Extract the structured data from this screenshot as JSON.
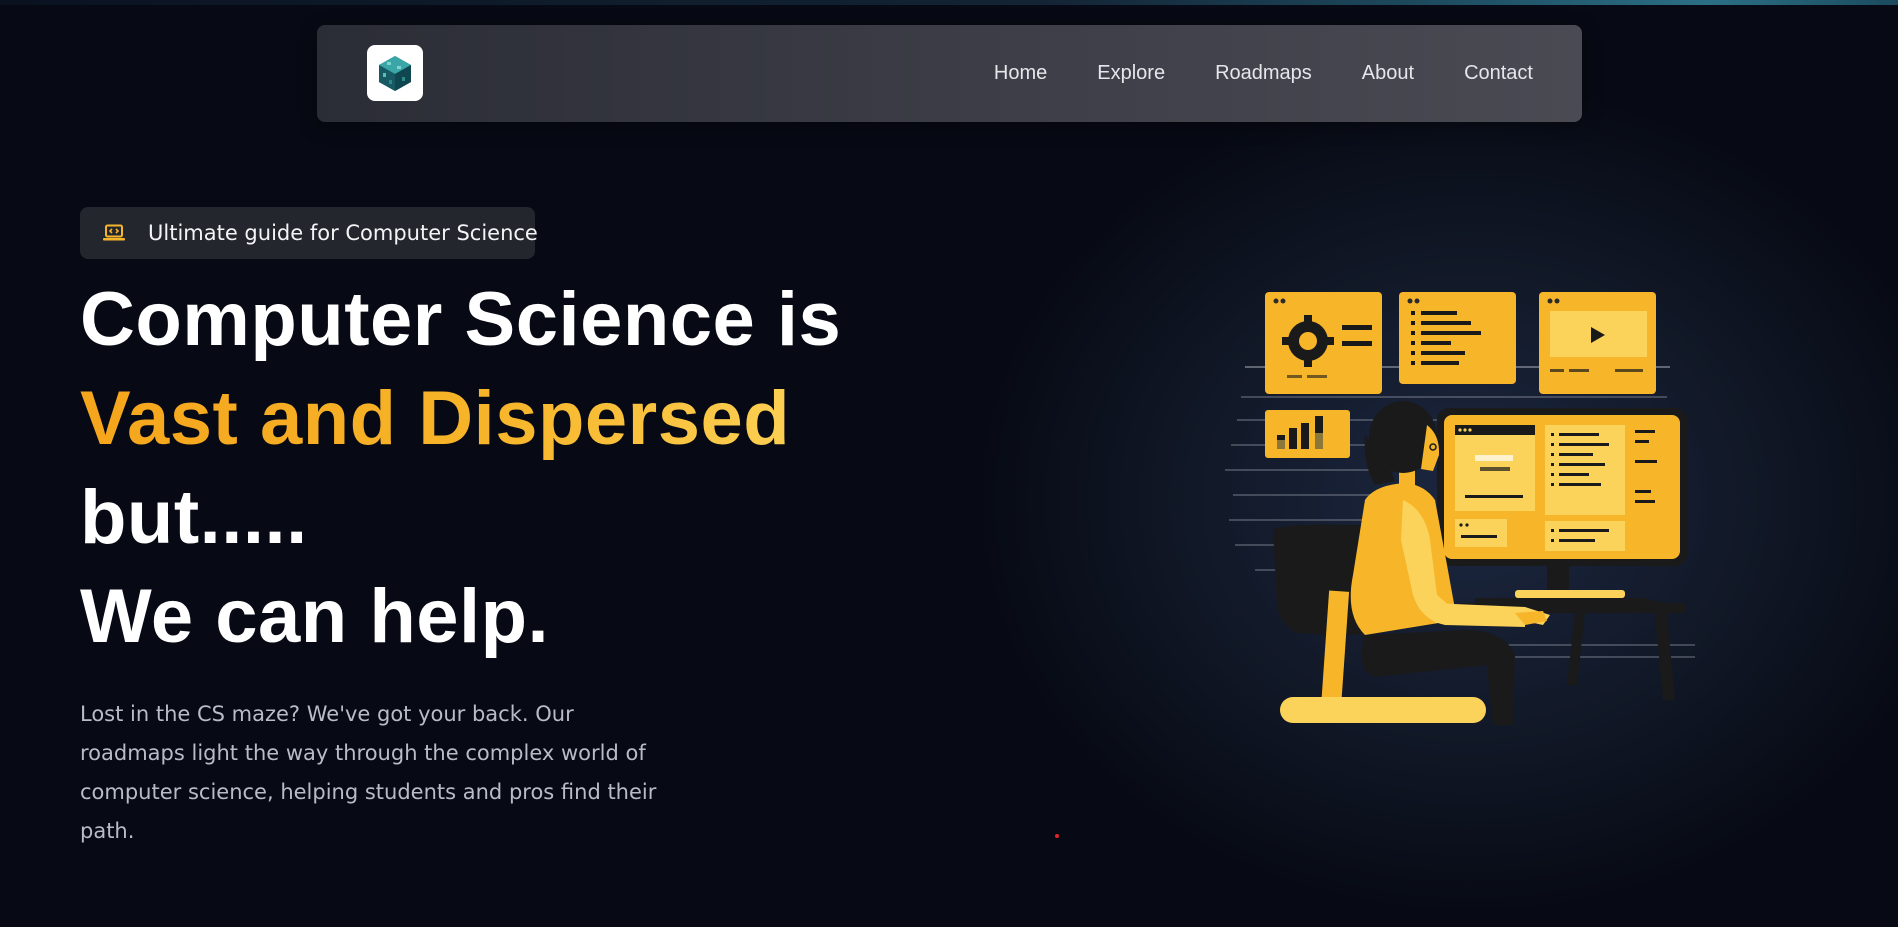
{
  "nav": {
    "logo_icon": "cube-logo-icon",
    "links": [
      "Home",
      "Explore",
      "Roadmaps",
      "About",
      "Contact"
    ]
  },
  "hero": {
    "badge": {
      "icon": "laptop-code-icon",
      "text": "Ultimate guide for Computer Science"
    },
    "headline": {
      "line1": "Computer Science is",
      "line2": "Vast and Dispersed",
      "line3": "but.....",
      "line4": "We can help."
    },
    "description": "Lost in the CS maze? We've got your back. Our roadmaps light the way through the complex world of computer science, helping students and pros find their path.",
    "illustration_icon": "person-at-computer-illustration"
  },
  "colors": {
    "accent": "#f7b52a",
    "accent_light": "#fcd35a",
    "background": "#070a14",
    "navbar": "#3d3e47"
  }
}
